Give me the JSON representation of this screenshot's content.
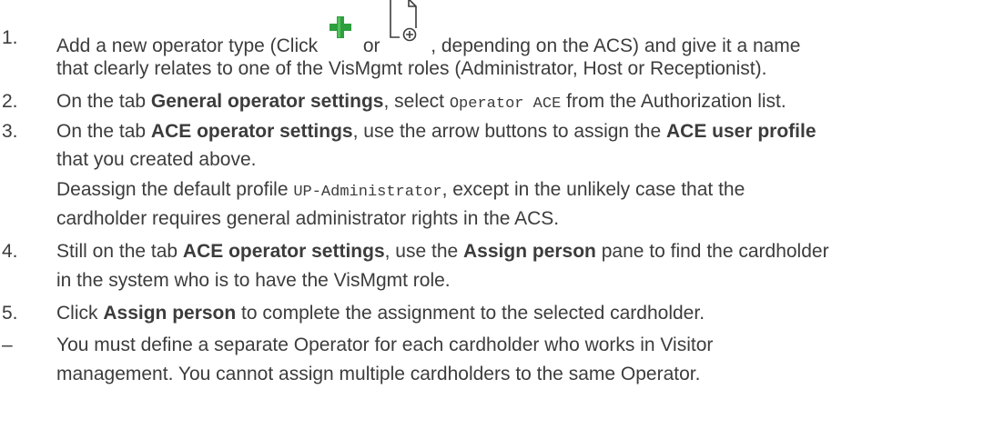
{
  "steps": [
    {
      "number": "1.",
      "l1": {
        "a": "Add a new operator type (Click",
        "b": "or",
        "c": ", depending on the ACS) and give it a name"
      },
      "l2": "that clearly relates to one of the VisMgmt roles (Administrator, Host or Receptionist)."
    },
    {
      "number": "2.",
      "a": "On the tab ",
      "b": "General operator settings",
      "c": ", select ",
      "d": "Operator ACE",
      "e": " from the Authorization list."
    },
    {
      "number": "3.",
      "l1": {
        "a": "On the tab ",
        "b": "ACE operator settings",
        "c": ", use the arrow buttons to assign the ",
        "d": "ACE user profile"
      },
      "l2": "that you created above.",
      "l3": {
        "a": "Deassign the default profile ",
        "b": "UP-Administrator",
        "c": ", except in the unlikely case that the"
      },
      "l4": "cardholder requires general administrator rights in the ACS."
    },
    {
      "number": "4.",
      "l1": {
        "a": "Still on the tab ",
        "b": "ACE operator settings",
        "c": ", use the ",
        "d": "Assign person",
        "e": " pane to find the cardholder"
      },
      "l2": "in the system who is to have the VisMgmt role."
    },
    {
      "number": "5.",
      "a": "Click ",
      "b": "Assign person",
      "c": " to complete the assignment to the selected cardholder."
    }
  ],
  "note": {
    "bullet": "–",
    "l1": "You must define a separate Operator for each cardholder who works in Visitor",
    "l2": "management. You cannot assign multiple cardholders to the same Operator."
  },
  "icons": {
    "add": {
      "name": "add-plus-icon",
      "color": "#2e9e3e"
    },
    "new_document": {
      "name": "new-document-icon",
      "color": "#3c3c3c"
    }
  }
}
